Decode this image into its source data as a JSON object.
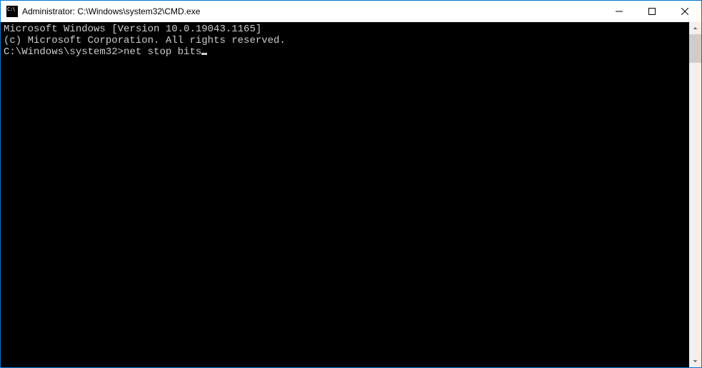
{
  "window": {
    "title": "Administrator: C:\\Windows\\system32\\CMD.exe"
  },
  "terminal": {
    "line1": "Microsoft Windows [Version 10.0.19043.1165]",
    "line2": "(c) Microsoft Corporation. All rights reserved.",
    "blank": "",
    "prompt": "C:\\Windows\\system32>",
    "command": "net stop bits"
  }
}
